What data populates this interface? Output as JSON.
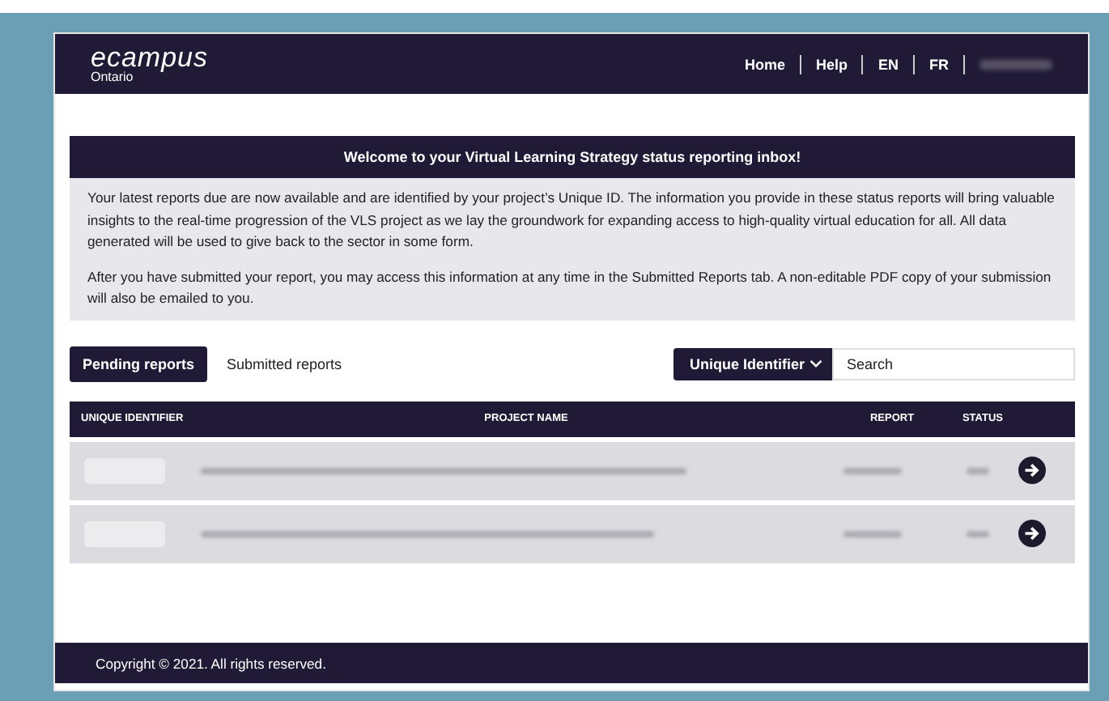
{
  "header": {
    "logo": "ecampus",
    "logo_sub": "Ontario",
    "nav": [
      {
        "label": "Home"
      },
      {
        "label": "Help"
      },
      {
        "label": "EN"
      },
      {
        "label": "FR"
      }
    ]
  },
  "welcome": {
    "title": "Welcome to your Virtual Learning Strategy status reporting inbox!",
    "paragraphs": [
      "Your latest reports due are now available and are identified by your project’s Unique ID. The information you provide in these status reports will bring valuable insights to the real-time progression of the VLS project as we lay the groundwork for expanding access to high-quality virtual education for all. All data generated will be used to give back to the sector in some form.",
      "After you have submitted your report, you may access this information at any time in the Submitted Reports tab. A non-editable PDF copy of your submission will also be emailed to you."
    ]
  },
  "tabs": [
    {
      "label": "Pending reports",
      "selected": true
    },
    {
      "label": "Submitted reports",
      "selected": false
    }
  ],
  "filter": {
    "select": "Unique Identifier",
    "placeholder": "Search"
  },
  "table": {
    "columns": [
      "UNIQUE IDENTIFIER",
      "PROJECT NAME",
      "REPORT",
      "STATUS"
    ]
  },
  "footer": {
    "text": "Copyright © 2021. All rights reserved."
  }
}
